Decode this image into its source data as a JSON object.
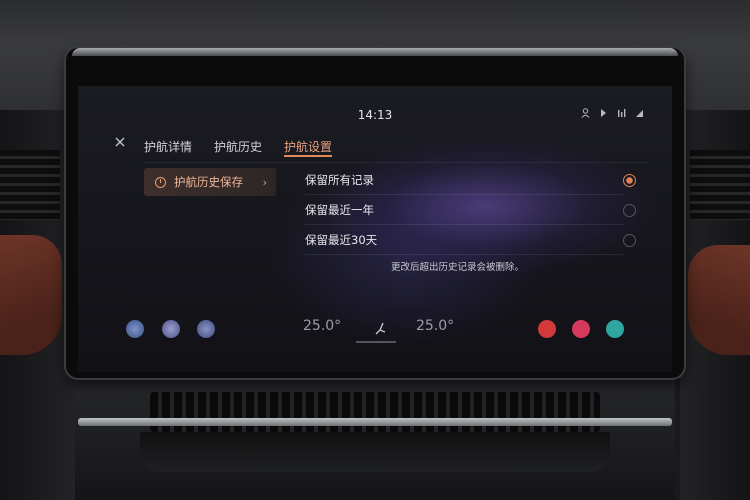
{
  "status_bar": {
    "time": "14:13",
    "icons": [
      "user-icon",
      "voice-icon",
      "signal-icon",
      "network-icon"
    ]
  },
  "header": {
    "close_icon": "close-icon",
    "tabs": [
      {
        "label": "护航详情",
        "active": false
      },
      {
        "label": "护航历史",
        "active": false
      },
      {
        "label": "护航设置",
        "active": true
      }
    ]
  },
  "sidebar": {
    "item": {
      "icon": "clock-icon",
      "label": "护航历史保存",
      "chevron": "chevron-right-icon"
    }
  },
  "options": [
    {
      "label": "保留所有记录",
      "selected": true
    },
    {
      "label": "保留最近一年",
      "selected": false
    },
    {
      "label": "保留最近30天",
      "selected": false
    }
  ],
  "note": "更改后超出历史记录会被删除。",
  "dock": {
    "left_buttons": [
      "app-icon-1",
      "app-icon-2",
      "app-icon-3"
    ],
    "temp_left": "25.0°",
    "temp_right": "25.0°",
    "seat_icon": "seat-icon",
    "right_buttons": [
      "navigation-icon",
      "music-icon",
      "phone-icon"
    ]
  },
  "colors": {
    "accent": "#e38a5a",
    "active_tab": "#e8a27e",
    "dock_nav": "#d23a3a",
    "dock_music": "#d5395b",
    "dock_phone": "#2fa7a0"
  }
}
